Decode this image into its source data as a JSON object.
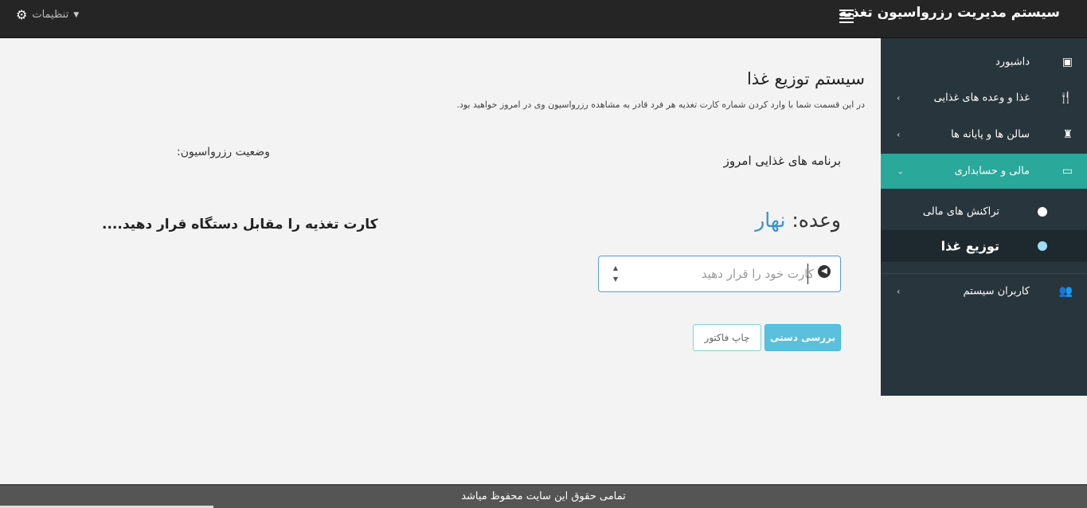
{
  "header": {
    "brand": "سیستم مدیریت رزرواسیون تغذیه",
    "settings_label": "تنظیمات",
    "settings_icon": "cogs-icon",
    "menu_icon": "hamburger-icon"
  },
  "sidebar": {
    "items": [
      {
        "label": "داشبورد",
        "icon": "dashboard-icon"
      },
      {
        "label": "غذا و وعده های غذایی",
        "icon": "utensils-icon"
      },
      {
        "label": "سالن ها و پایانه ها",
        "icon": "tower-icon"
      },
      {
        "label": "مالی و حسابداری",
        "icon": "money-icon"
      },
      {
        "label": "کاربران سیستم",
        "icon": "users-icon"
      }
    ],
    "sub_items": [
      {
        "label": "تراکنش های مالی"
      },
      {
        "label": "توزیع غذا"
      }
    ],
    "active_color": "#2aa89a"
  },
  "main": {
    "title": "سیستم توزیع غذا",
    "description": "در این قسمت شما با وارد کردن شماره کارت تغذیه هر فرد قادر به مشاهده رزرواسیون وی در امروز خواهید بود.",
    "today_programs": "برنامه های غذایی امروز",
    "reserve_status": "وضعیت رزرواسیون:",
    "meal_label": "وعده:",
    "meal_value": "نهار",
    "card_message": "کارت تغذیه را مقابل دستگاه قرار دهید....",
    "card_input": {
      "placeholder": "کارت خود را قرار دهید",
      "value": ""
    },
    "buttons": {
      "manual_check": "بررسی دستی",
      "print_invoice": "چاپ فاکتور"
    }
  },
  "footer": {
    "text": "تمامی حقوق این سایت محفوظ میاشد"
  }
}
